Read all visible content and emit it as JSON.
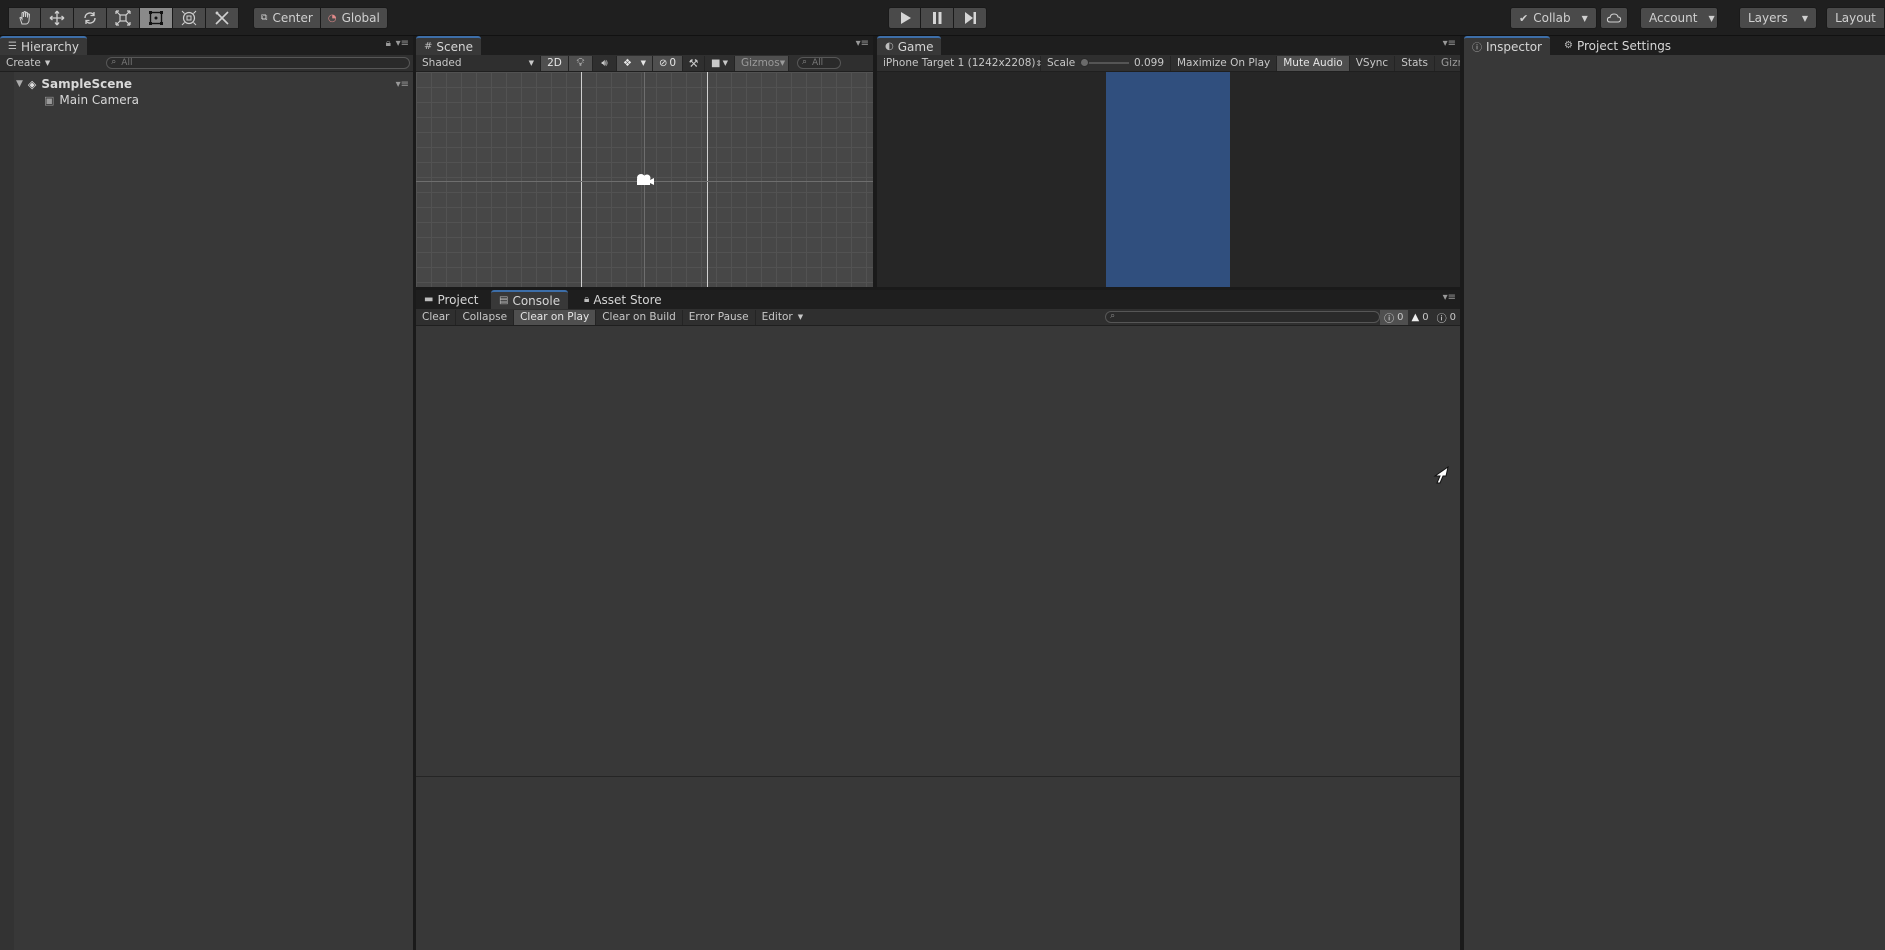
{
  "toolbar": {
    "tools": [
      {
        "name": "hand-tool",
        "icon": "hand-icon"
      },
      {
        "name": "move-tool",
        "icon": "move-icon"
      },
      {
        "name": "rotate-tool",
        "icon": "rotate-icon"
      },
      {
        "name": "scale-tool",
        "icon": "scale-icon"
      },
      {
        "name": "rect-tool",
        "icon": "rect-icon"
      },
      {
        "name": "transform-tool",
        "icon": "transform-icon"
      },
      {
        "name": "custom-tool",
        "icon": "tools-icon"
      }
    ],
    "pivot_label": "Center",
    "space_label": "Global",
    "collab_label": "Collab",
    "account_label": "Account",
    "layers_label": "Layers",
    "layout_label": "Layout"
  },
  "hierarchy": {
    "tab_label": "Hierarchy",
    "create_label": "Create",
    "search_placeholder": "All",
    "scene_name": "SampleScene",
    "items": [
      {
        "label": "Main Camera"
      }
    ]
  },
  "scene": {
    "tab_label": "Scene",
    "shading_mode": "Shaded",
    "mode_2d": "2D",
    "hidden_count": "0",
    "gizmos_label": "Gizmos",
    "search_placeholder": "All"
  },
  "game": {
    "tab_label": "Game",
    "display_label": "iPhone Target 1 (1242x2208)",
    "scale_label": "Scale",
    "scale_value": "0.099",
    "scale_fraction": 0.0,
    "maximize_label": "Maximize On Play",
    "mute_label": "Mute Audio",
    "vsync_label": "VSync",
    "stats_label": "Stats",
    "gizmos_label": "Gizmos",
    "background_color": "#304f7e"
  },
  "bottom_tabs": {
    "project_label": "Project",
    "console_label": "Console",
    "asset_store_label": "Asset Store"
  },
  "console": {
    "clear_label": "Clear",
    "collapse_label": "Collapse",
    "clear_on_play_label": "Clear on Play",
    "clear_on_build_label": "Clear on Build",
    "error_pause_label": "Error Pause",
    "editor_label": "Editor",
    "log_count": "0",
    "warning_count": "0",
    "error_count": "0"
  },
  "inspector": {
    "tab_label": "Inspector",
    "project_settings_label": "Project Settings"
  },
  "colors": {
    "accent": "#3d6ea8",
    "panel": "#383838",
    "toolbar": "#1f1f1f"
  }
}
